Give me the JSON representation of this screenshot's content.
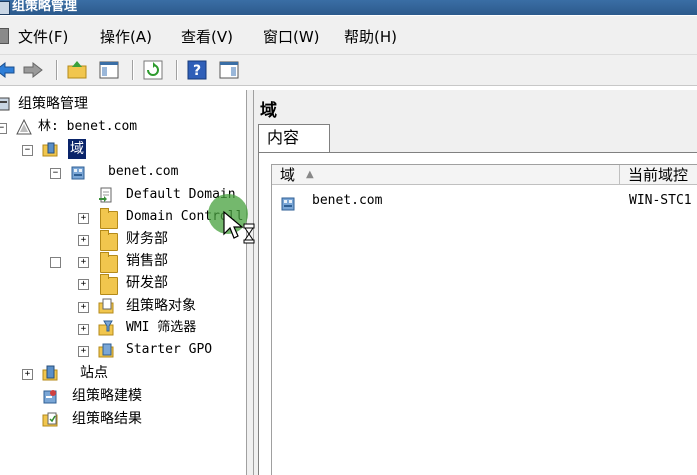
{
  "window": {
    "title": "组策略管理"
  },
  "menu": {
    "file": "文件(F)",
    "action": "操作(A)",
    "view": "查看(V)",
    "window": "窗口(W)",
    "help": "帮助(H)"
  },
  "toolbar": {
    "buttons": [
      "back-icon",
      "forward-icon",
      "up-folder-icon",
      "show-hide-tree-icon",
      "refresh-icon",
      "help-icon",
      "action-pane-icon"
    ]
  },
  "tree": {
    "root": "组策略管理",
    "forest": "林: benet.com",
    "domains": "域",
    "domain": "benet.com",
    "default_domain": "Default Domain",
    "domain_controllers": "Domain Controll",
    "ou_finance": "财务部",
    "ou_sales": "销售部",
    "ou_rd": "研发部",
    "gpo_objects": "组策略对象",
    "wmi_filters": "WMI 筛选器",
    "starter_gpo": "Starter GPO",
    "sites": "站点",
    "modeling": "组策略建模",
    "results": "组策略结果"
  },
  "panel": {
    "title": "域",
    "tab_contents": "内容",
    "columns": [
      "域",
      "当前域控"
    ],
    "rows": [
      {
        "domain": "benet.com",
        "dc": "WIN-STC1"
      }
    ]
  },
  "colors": {
    "selection": "#0a246a",
    "titlebar": "#3a6ea5",
    "cursor_highlight": "#46a03c"
  }
}
